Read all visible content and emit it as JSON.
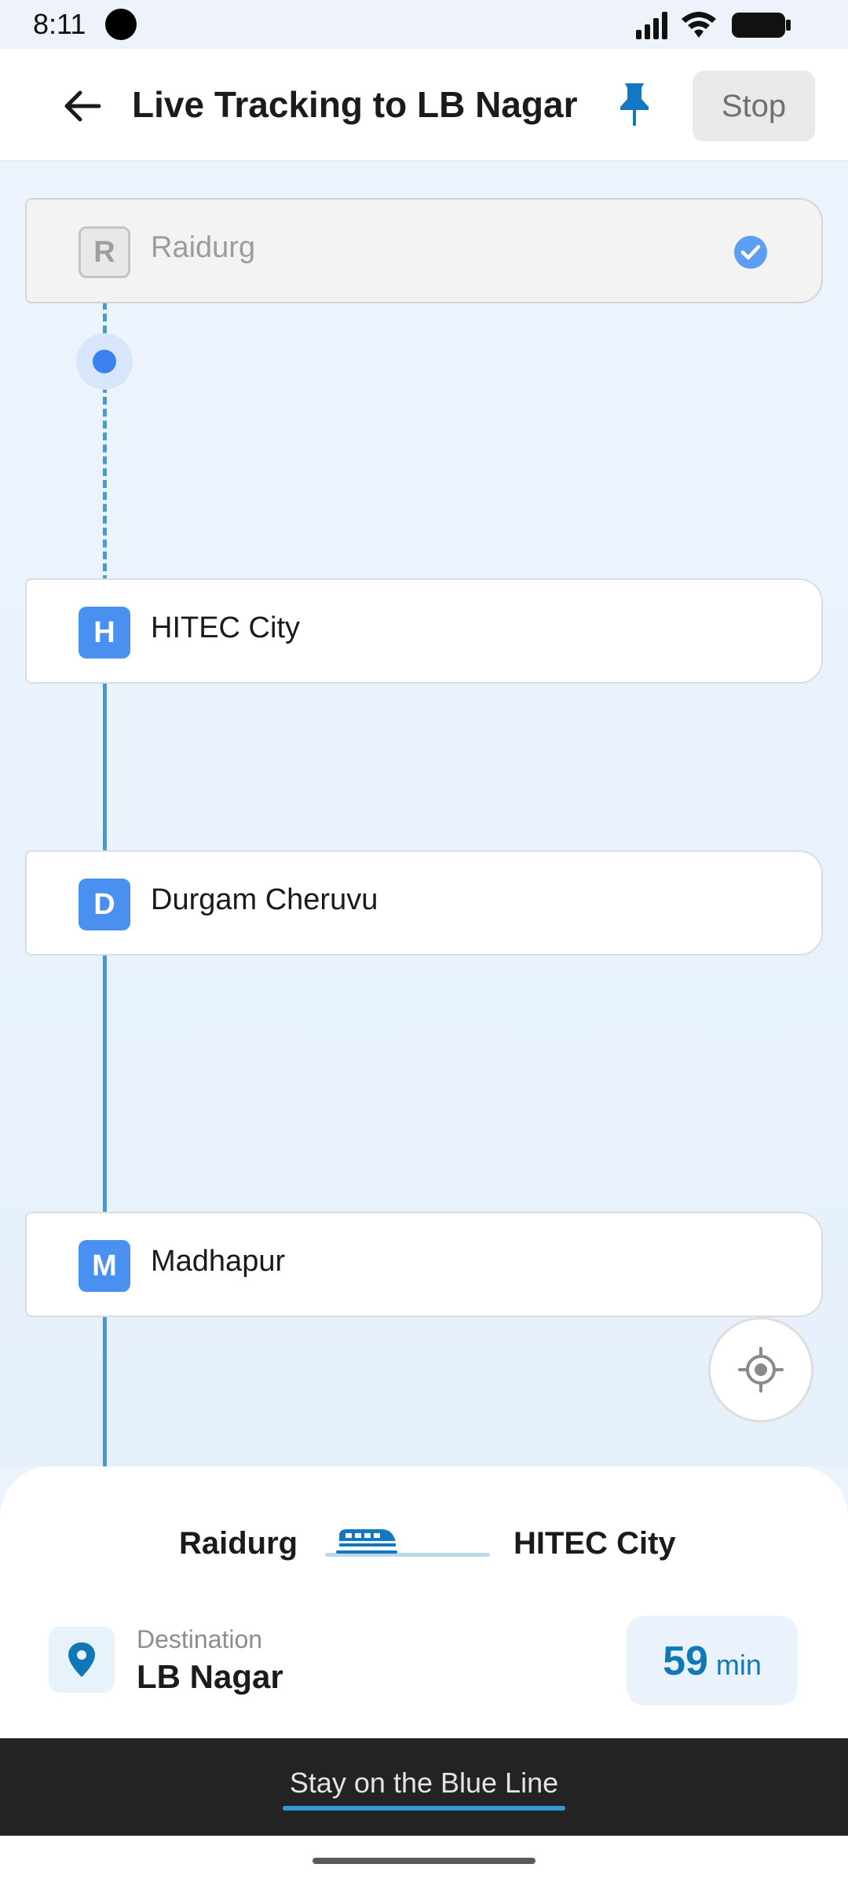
{
  "status_bar": {
    "time": "8:11",
    "icons": [
      "camera-dot-icon",
      "signal-icon",
      "wifi-icon",
      "battery-icon"
    ]
  },
  "header": {
    "back_icon": "arrow-left-icon",
    "title": "Live Tracking to LB Nagar",
    "pin_icon": "pin-icon",
    "stop_label": "Stop"
  },
  "route": {
    "stations": [
      {
        "letter": "R",
        "name": "Raidurg",
        "status": "passed"
      },
      {
        "letter": "H",
        "name": "HITEC City",
        "status": "upcoming"
      },
      {
        "letter": "D",
        "name": "Durgam Cheruvu",
        "status": "upcoming"
      },
      {
        "letter": "M",
        "name": "Madhapur",
        "status": "upcoming"
      }
    ],
    "locate_icon": "locate-crosshair-icon"
  },
  "trip": {
    "from": "Raidurg",
    "to": "HITEC City",
    "train_icon": "train-icon",
    "destination_label": "Destination",
    "destination_name": "LB Nagar",
    "destination_icon": "location-pin-icon",
    "eta_value": "59",
    "eta_unit": "min"
  },
  "footer": {
    "message": "Stay on the Blue Line"
  },
  "colors": {
    "accent": "#1178b7",
    "line": "#3a9ed0",
    "badge": "#4a90f0"
  }
}
